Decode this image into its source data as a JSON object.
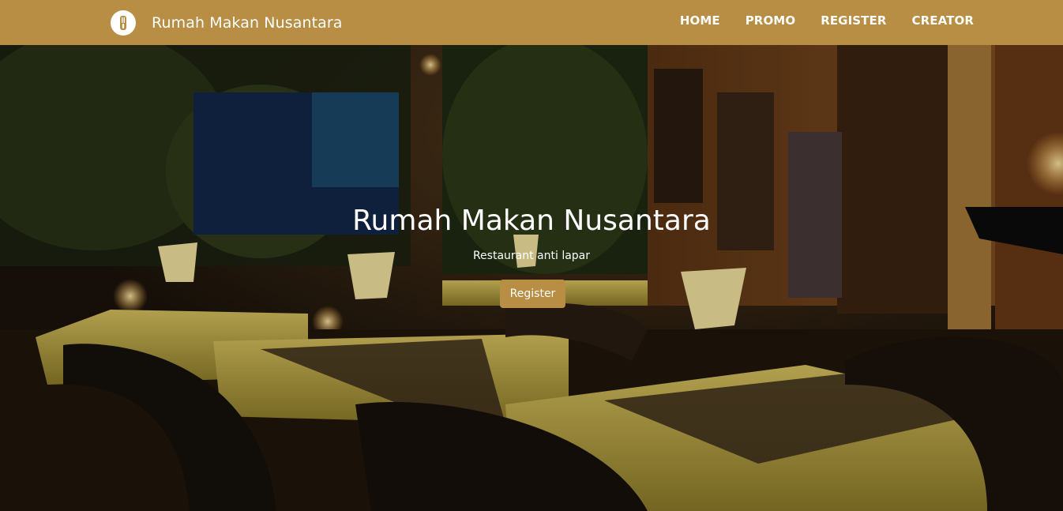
{
  "navbar": {
    "brand_name": "Rumah Makan Nusantara",
    "logo_icon": "utensils-icon",
    "links": [
      {
        "label": "HOME"
      },
      {
        "label": "PROMO"
      },
      {
        "label": "REGISTER"
      },
      {
        "label": "CREATOR"
      }
    ],
    "background_color": "#b88d44"
  },
  "hero": {
    "title": "Rumah Makan Nusantara",
    "subtitle": "Restaurant anti lapar",
    "button_label": "Register",
    "background_image": "restaurant-interior-photo",
    "button_color": "#b88d44"
  }
}
